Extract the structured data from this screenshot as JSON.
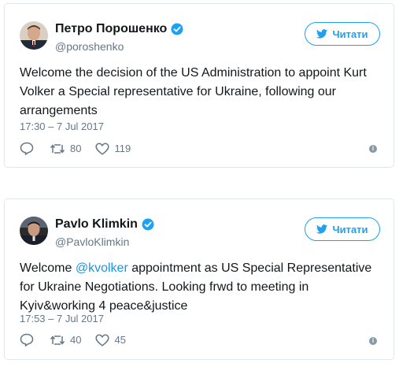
{
  "tweets": [
    {
      "name": "Петро Порошенко",
      "handle": "@poroshenko",
      "follow_label": "Читати",
      "text_before": "Welcome the decision of the US Administration to appoint Kurt Volker a Special representative for Ukraine, following our arrangements",
      "mention": "",
      "text_after": "",
      "time": "17:30 – 7 Jul 2017",
      "retweets": "80",
      "likes": "119"
    },
    {
      "name": "Pavlo Klimkin",
      "handle": "@PavloKlimkin",
      "follow_label": "Читати",
      "text_before": "Welcome ",
      "mention": "@kvolker",
      "text_after": " appointment as US Special Representative for Ukraine Negotiations. Looking frwd to meeting in Kyiv&working 4 peace&justice",
      "time": "17:53 – 7 Jul 2017",
      "retweets": "40",
      "likes": "45"
    }
  ],
  "colors": {
    "accent": "#1da1f2",
    "mention": "#1b95e0",
    "muted": "#657786",
    "border": "#e1e8ed"
  },
  "icons": [
    "verified-badge-icon",
    "twitter-bird-icon",
    "reply-icon",
    "retweet-icon",
    "heart-icon",
    "info-icon"
  ]
}
